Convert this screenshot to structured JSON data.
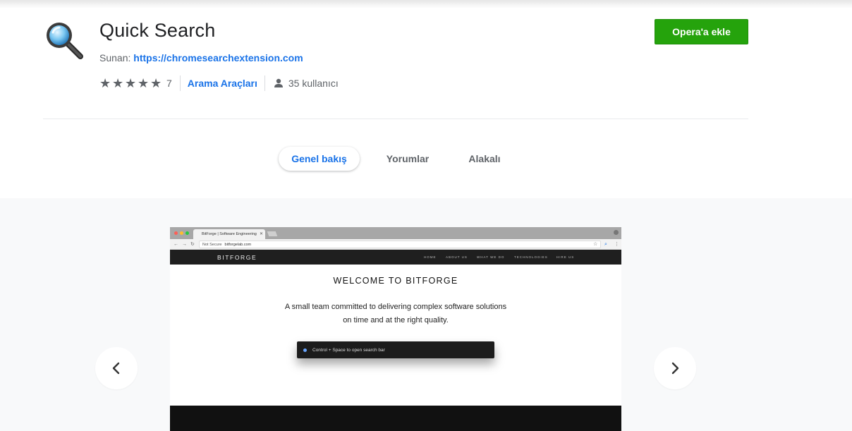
{
  "extension": {
    "title": "Quick Search",
    "offered_by_label": "Sunan:",
    "offered_by_url": "https://chromesearchextension.com",
    "add_button_label": "Opera'a ekle",
    "rating": 5,
    "rating_count": "7",
    "category": "Arama Araçları",
    "users": "35 kullanıcı"
  },
  "tabs": [
    {
      "label": "Genel bakış",
      "active": true
    },
    {
      "label": "Yorumlar",
      "active": false
    },
    {
      "label": "Alakalı",
      "active": false
    }
  ],
  "gallery": {
    "prev_icon": "chevron-left-icon",
    "next_icon": "chevron-right-icon",
    "screenshot": {
      "tab_title": "BitForge | Software Engineering",
      "not_secure": "Not Secure",
      "url": "bitforgelab.com",
      "brand": "BITFORGE",
      "menu": [
        "HOME",
        "ABOUT US",
        "WHAT WE DO",
        "TECHNOLOGIES",
        "HIRE US"
      ],
      "heading": "WELCOME TO BITFORGE",
      "tagline_line1": "A small team committed to delivering complex software solutions",
      "tagline_line2": "on time and at the right quality.",
      "search_hint": "Control + Space to open search bar"
    }
  },
  "colors": {
    "accent": "#1a73e8",
    "add_button": "#25a30c",
    "text_muted": "#5f6368"
  }
}
